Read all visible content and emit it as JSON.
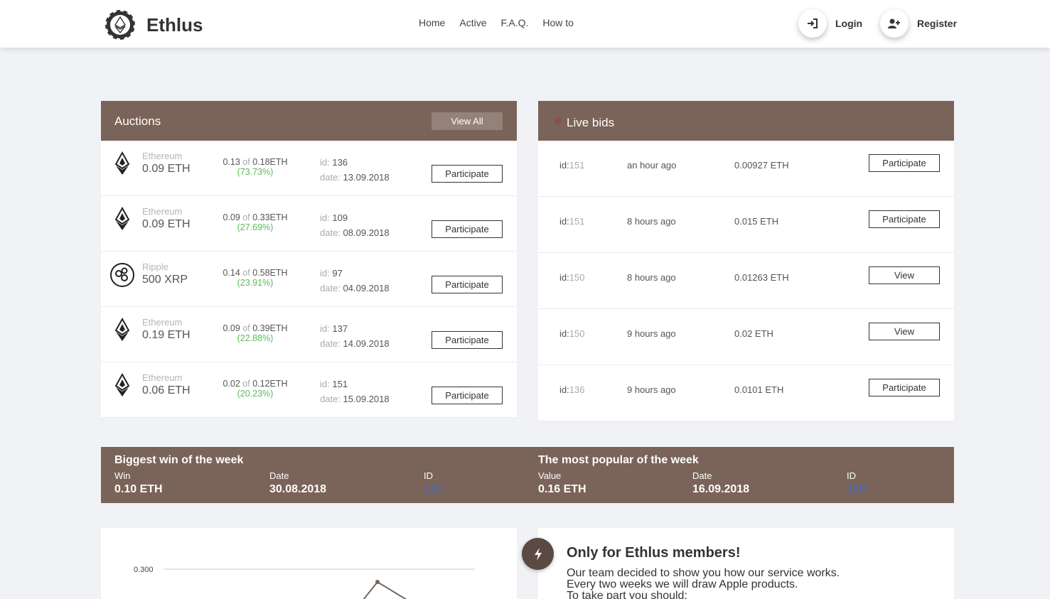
{
  "brand": {
    "name": "Ethlus"
  },
  "nav": {
    "items": [
      "Home",
      "Active",
      "F.A.Q.",
      "How to"
    ]
  },
  "auth": {
    "login": "Login",
    "register": "Register"
  },
  "auctions": {
    "title": "Auctions",
    "view_all": "View All",
    "of_word": "of",
    "id_label": "id:",
    "date_label": "date:",
    "rows": [
      {
        "icon": "ethereum-icon",
        "coin": "Ethereum",
        "amount": "0.09 ETH",
        "raised": "0.13",
        "target": "0.18ETH",
        "percent": "(73.73%)",
        "id": "136",
        "date": "13.09.2018",
        "button": "Participate"
      },
      {
        "icon": "ethereum-icon",
        "coin": "Ethereum",
        "amount": "0.09 ETH",
        "raised": "0.09",
        "target": "0.33ETH",
        "percent": "(27.69%)",
        "id": "109",
        "date": "08.09.2018",
        "button": "Participate"
      },
      {
        "icon": "ripple-icon",
        "coin": "Ripple",
        "amount": "500 XRP",
        "raised": "0.14",
        "target": "0.58ETH",
        "percent": "(23.91%)",
        "id": "97",
        "date": "04.09.2018",
        "button": "Participate"
      },
      {
        "icon": "ethereum-icon",
        "coin": "Ethereum",
        "amount": "0.19 ETH",
        "raised": "0.09",
        "target": "0.39ETH",
        "percent": "(22.88%)",
        "id": "137",
        "date": "14.09.2018",
        "button": "Participate"
      },
      {
        "icon": "ethereum-icon",
        "coin": "Ethereum",
        "amount": "0.06 ETH",
        "raised": "0.02",
        "target": "0.12ETH",
        "percent": "(20.23%)",
        "id": "151",
        "date": "15.09.2018",
        "button": "Participate"
      }
    ]
  },
  "live_bids": {
    "title": "Live bids",
    "id_label": "id:",
    "rows": [
      {
        "id": "151",
        "time": "an hour ago",
        "amount": "0.00927 ETH",
        "button": "Participate"
      },
      {
        "id": "151",
        "time": "8 hours ago",
        "amount": "0.015 ETH",
        "button": "Participate"
      },
      {
        "id": "150",
        "time": "8 hours ago",
        "amount": "0.01263 ETH",
        "button": "View"
      },
      {
        "id": "150",
        "time": "9 hours ago",
        "amount": "0.02 ETH",
        "button": "View"
      },
      {
        "id": "136",
        "time": "9 hours ago",
        "amount": "0.0101 ETH",
        "button": "Participate"
      }
    ]
  },
  "biggest_win": {
    "title": "Biggest win of the week",
    "win_label": "Win",
    "win": "0.10 ETH",
    "date_label": "Date",
    "date": "30.08.2018",
    "id_label": "ID",
    "id": "126"
  },
  "most_popular": {
    "title": "The most popular of the week",
    "value_label": "Value",
    "value": "0.16 ETH",
    "date_label": "Date",
    "date": "16.09.2018",
    "id_label": "ID",
    "id": "126"
  },
  "chart_data": {
    "type": "line",
    "y_tick_labels": [
      "0.300"
    ],
    "series": [
      {
        "values": [
          0.302
        ]
      }
    ],
    "grid": true
  },
  "members": {
    "title": "Only for Ethlus members!",
    "lines": [
      "Our team decided to show you how our service works.",
      "Every two weeks we will draw Apple products.",
      "To take part you should:"
    ]
  },
  "colors": {
    "brand_brown": "#7a6358",
    "percent_green": "#5cb85c",
    "link_blue": "#3b6fcf"
  }
}
